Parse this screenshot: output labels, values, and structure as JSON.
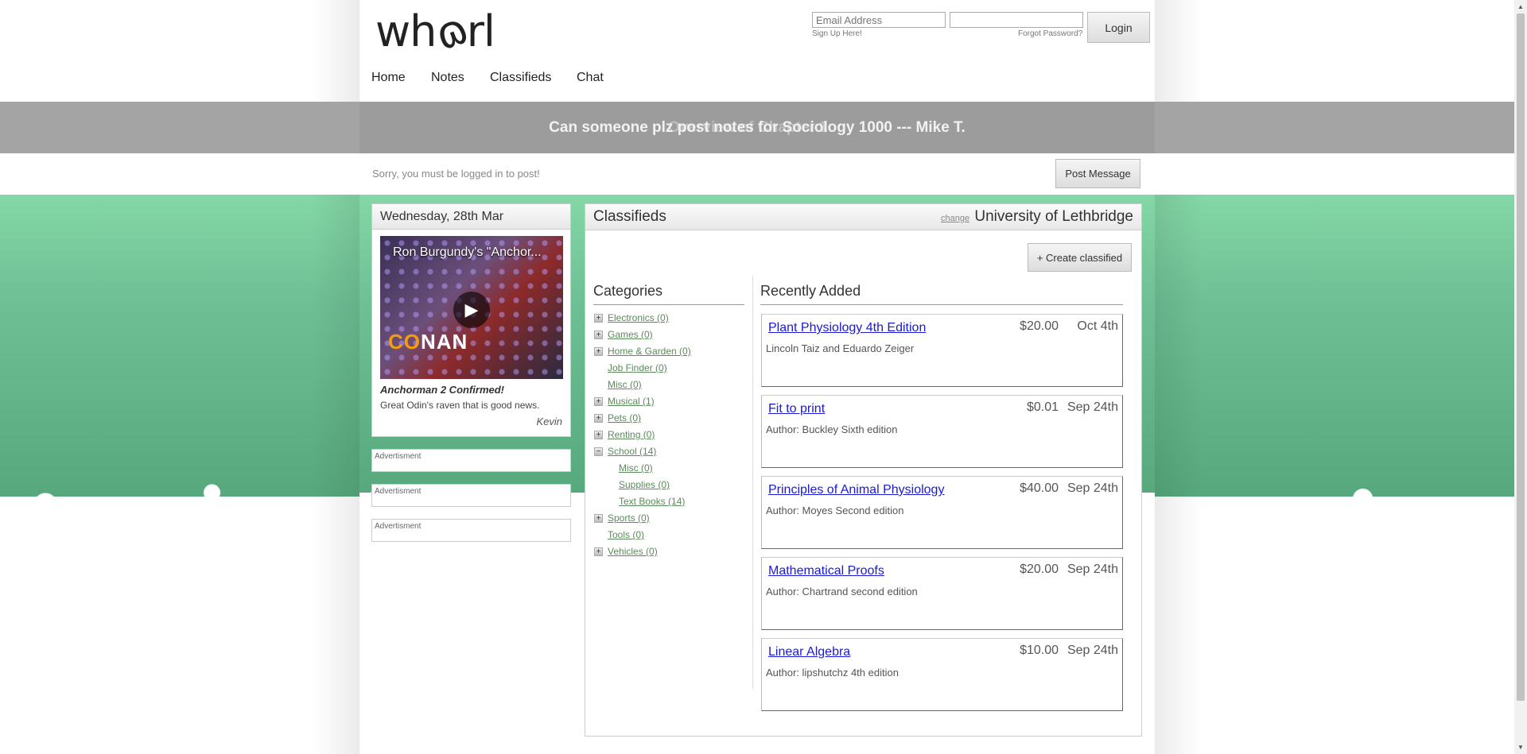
{
  "header": {
    "logo_text": "wh",
    "logo_swirl": "ɷ",
    "logo_tail": "rl",
    "email_placeholder": "Email Address",
    "signup_label": "Sign Up Here!",
    "forgot_label": "Forgot Password?",
    "login_label": "Login"
  },
  "nav": {
    "items": [
      {
        "label": "Home"
      },
      {
        "label": "Notes"
      },
      {
        "label": "Classifieds"
      },
      {
        "label": "Chat"
      }
    ]
  },
  "banner": {
    "message": "Can someone plz post notes for Sociology 1000 --- Mike T.",
    "ghost": "Overview of Chapter 1"
  },
  "post": {
    "notice": "Sorry, you must be logged in to post!",
    "button_label": "Post Message"
  },
  "day": {
    "date": "Wednesday, 28th Mar",
    "video_title": "Ron Burgundy's \"Anchor...",
    "video_brand_accent": "CO",
    "video_brand_rest": "NAN",
    "headline": "Anchorman 2 Confirmed!",
    "text": "Great Odin's raven that is good news.",
    "author": "Kevin"
  },
  "ads": [
    {
      "label": "Advertisment"
    },
    {
      "label": "Advertisment"
    },
    {
      "label": "Advertisment"
    }
  ],
  "classifieds": {
    "title": "Classifieds",
    "change_label": "change",
    "university": "University of Lethbridge",
    "create_label": "+ Create classified",
    "categories_title": "Categories",
    "recent_title": "Recently Added",
    "categories": [
      {
        "label": "Electronics (0)",
        "icon": "+"
      },
      {
        "label": "Games (0)",
        "icon": "+"
      },
      {
        "label": "Home & Garden (0)",
        "icon": "+"
      },
      {
        "label": "Job Finder (0)",
        "icon": ""
      },
      {
        "label": "Misc (0)",
        "icon": ""
      },
      {
        "label": "Musical (1)",
        "icon": "+"
      },
      {
        "label": "Pets (0)",
        "icon": "+"
      },
      {
        "label": "Renting (0)",
        "icon": "+"
      },
      {
        "label": "School (14)",
        "icon": "−"
      },
      {
        "label": "Misc (0)",
        "icon": ""
      },
      {
        "label": "Supplies (0)",
        "icon": ""
      },
      {
        "label": "Text Books (14)",
        "icon": ""
      },
      {
        "label": "Sports (0)",
        "icon": "+"
      },
      {
        "label": "Tools (0)",
        "icon": ""
      },
      {
        "label": "Vehicles (0)",
        "icon": "+"
      }
    ],
    "listings": [
      {
        "title": "Plant Physiology 4th Edition",
        "price": "$20.00",
        "date": "Oct 4th",
        "desc": "Lincoln Taiz and Eduardo Zeiger"
      },
      {
        "title": "Fit to print",
        "price": "$0.01",
        "date": "Sep 24th",
        "desc": "Author: Buckley Sixth edition"
      },
      {
        "title": "Principles of Animal Physiology",
        "price": "$40.00",
        "date": "Sep 24th",
        "desc": "Author: Moyes Second edition"
      },
      {
        "title": "Mathematical Proofs",
        "price": "$20.00",
        "date": "Sep 24th",
        "desc": "Author: Chartrand second edition"
      },
      {
        "title": "Linear Algebra",
        "price": "$10.00",
        "date": "Sep 24th",
        "desc": "Author: lipshutchz 4th edition"
      }
    ]
  }
}
